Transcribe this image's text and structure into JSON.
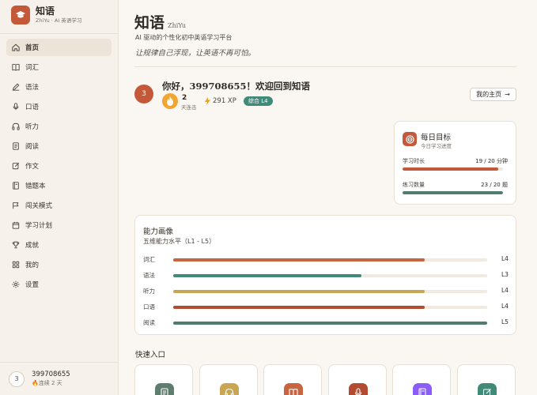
{
  "brand": {
    "title": "知语",
    "subtitle": "ZhiYu · AI 英语学习"
  },
  "nav": [
    {
      "label": "首页",
      "icon": "home-icon",
      "active": true
    },
    {
      "label": "词汇",
      "icon": "book-icon"
    },
    {
      "label": "语法",
      "icon": "pen-icon"
    },
    {
      "label": "口语",
      "icon": "mic-icon"
    },
    {
      "label": "听力",
      "icon": "headphones-icon"
    },
    {
      "label": "阅读",
      "icon": "document-icon"
    },
    {
      "label": "作文",
      "icon": "edit-icon"
    },
    {
      "label": "错题本",
      "icon": "notebook-icon"
    },
    {
      "label": "闯关模式",
      "icon": "flag-icon"
    },
    {
      "label": "学习计划",
      "icon": "calendar-icon"
    },
    {
      "label": "成就",
      "icon": "trophy-icon"
    },
    {
      "label": "我的",
      "icon": "grid-icon"
    },
    {
      "label": "设置",
      "icon": "gear-icon"
    }
  ],
  "user": {
    "avatar": "3",
    "name": "399708655",
    "streak": "连续 2 天"
  },
  "header": {
    "title": "知语",
    "title_en": "ZhiYu",
    "subtitle": "AI 驱动的个性化初中英语学习平台",
    "slogan": "让规律自己浮现，让英语不再可怕。"
  },
  "welcome": {
    "avatar": "3",
    "title": "你好，399708655！欢迎回到知语",
    "streak_count": "2",
    "streak_label": "天连击",
    "xp": "291 XP",
    "level": "综合 L4",
    "home_button": "我的主页"
  },
  "goals": {
    "title": "每日目标",
    "subtitle": "今日学习进度",
    "items": [
      {
        "label": "学习时长",
        "value": "19 / 20 分钟",
        "progress": 0.95,
        "color": "#c4593a"
      },
      {
        "label": "练习数量",
        "value": "23 / 20 题",
        "progress": 1.0,
        "color": "#4f7d6e"
      }
    ]
  },
  "ability": {
    "title": "能力画像",
    "subtitle": "五维能力水平（L1 - L5）",
    "skills": [
      {
        "label": "词汇",
        "level": "L4",
        "progress": 0.8,
        "color": "#c8643f"
      },
      {
        "label": "语法",
        "level": "L3",
        "progress": 0.6,
        "color": "#3f8b78"
      },
      {
        "label": "听力",
        "level": "L4",
        "progress": 0.8,
        "color": "#c9a654"
      },
      {
        "label": "口语",
        "level": "L4",
        "progress": 0.8,
        "color": "#b34a32"
      },
      {
        "label": "阅读",
        "level": "L5",
        "progress": 1.0,
        "color": "#4f7d6e"
      }
    ]
  },
  "quick": {
    "title": "快速入口",
    "items": [
      {
        "icon": "document-icon",
        "color": "#5e7d6f"
      },
      {
        "icon": "headphones-icon",
        "color": "#c9a654"
      },
      {
        "icon": "book-icon",
        "color": "#c8643f"
      },
      {
        "icon": "mic-icon",
        "color": "#b34a32"
      },
      {
        "icon": "notebook-icon",
        "color": "#8b5cf6"
      },
      {
        "icon": "edit-icon",
        "color": "#3f8b78"
      }
    ]
  }
}
